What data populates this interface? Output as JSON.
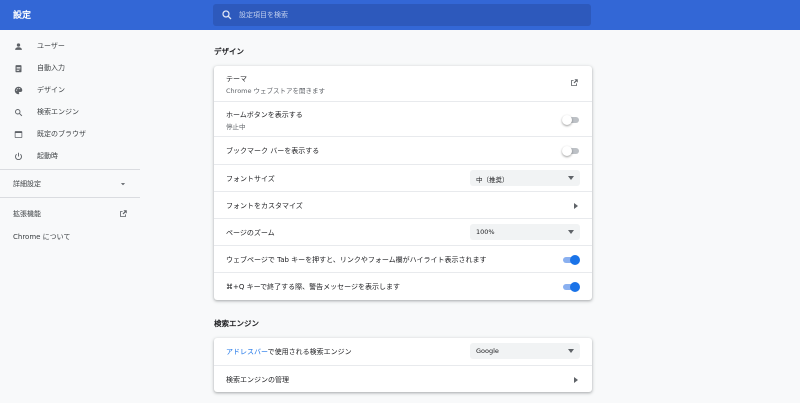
{
  "header": {
    "title": "設定",
    "search_placeholder": "設定項目を検索"
  },
  "sidebar": {
    "items": [
      {
        "label": "ユーザー",
        "icon": "person-icon"
      },
      {
        "label": "自動入力",
        "icon": "clipboard-icon"
      },
      {
        "label": "デザイン",
        "icon": "palette-icon"
      },
      {
        "label": "検索エンジン",
        "icon": "search-icon"
      },
      {
        "label": "既定のブラウザ",
        "icon": "browser-window-icon"
      },
      {
        "label": "起動時",
        "icon": "power-icon"
      }
    ],
    "advanced_label": "詳細設定",
    "extensions_label": "拡張機能",
    "about_label": "Chrome について"
  },
  "design": {
    "section_title": "デザイン",
    "theme_label": "テーマ",
    "theme_sub": "Chrome ウェブストアを開きます",
    "home_button_label": "ホームボタンを表示する",
    "home_button_sub": "停止中",
    "home_button_on": false,
    "bookmark_bar_label": "ブックマーク バーを表示する",
    "bookmark_bar_on": false,
    "font_size_label": "フォントサイズ",
    "font_size_value": "中（推奨）",
    "customize_fonts_label": "フォントをカスタマイズ",
    "page_zoom_label": "ページのズーム",
    "page_zoom_value": "100%",
    "tab_highlight_label": "ウェブページで Tab キーを押すと、リンクやフォーム欄がハイライト表示されます",
    "tab_highlight_on": true,
    "quit_warning_label": "⌘+Q キーで終了する際、警告メッセージを表示します",
    "quit_warning_on": true
  },
  "search_engine": {
    "section_title": "検索エンジン",
    "address_bar_link": "アドレスバー",
    "address_bar_rest": "で使用される検索エンジン",
    "engine_value": "Google",
    "manage_label": "検索エンジンの管理"
  },
  "colors": {
    "header_bg": "#3367d6",
    "accent": "#1a73e8"
  }
}
